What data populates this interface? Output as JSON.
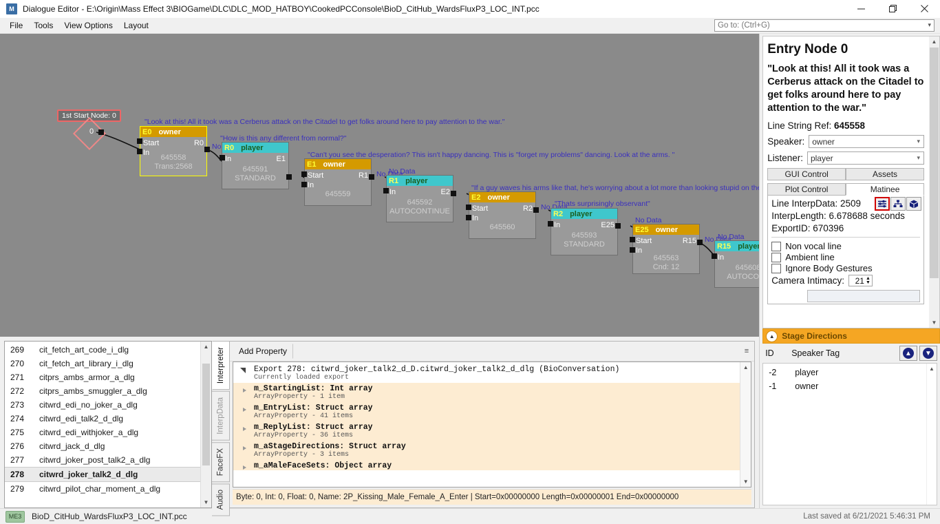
{
  "window": {
    "app_icon_text": "M",
    "title": "Dialogue Editor - E:\\Origin\\Mass Effect 3\\BIOGame\\DLC\\DLC_MOD_HATBOY\\CookedPCConsole\\BioD_CitHub_WardsFluxP3_LOC_INT.pcc",
    "minimize": "—",
    "maximize": "❐",
    "close": "✕"
  },
  "menubar": {
    "items": [
      "File",
      "Tools",
      "View Options",
      "Layout"
    ],
    "goto_placeholder": "Go to: (Ctrl+G)",
    "goto_value": ""
  },
  "graph": {
    "start_chip": "1st Start Node: 0",
    "diamond_label": "0",
    "nodes": [
      {
        "id": "E0",
        "type": "entry",
        "speaker": "owner",
        "selected": true,
        "left_ports": [
          "Start",
          "In"
        ],
        "right_port": "R0",
        "lines": [
          "645558",
          "Trans:2568"
        ],
        "dialogue": "\"Look at this! All it took was a Cerberus attack on the Citadel to get folks around here to pay attention to the war.\"",
        "outlabel": "No Data"
      },
      {
        "id": "R0",
        "type": "reply",
        "speaker": "player",
        "selected": false,
        "left_ports": [
          "In"
        ],
        "right_port": "E1",
        "lines": [
          "645591",
          "STANDARD"
        ],
        "dialogue": "\"How is this any different from normal?\"",
        "outlabel": "No Data"
      },
      {
        "id": "E1",
        "type": "entry",
        "speaker": "owner",
        "selected": false,
        "left_ports": [
          "Start",
          "In"
        ],
        "right_port": "R1",
        "lines": [
          "645559"
        ],
        "dialogue": "\"Can't you see the desperation? This isn't happy dancing. This is \"forget my problems\" dancing. Look at the arms. \"",
        "outlabel": "No Data"
      },
      {
        "id": "R1",
        "type": "reply",
        "speaker": "player",
        "selected": false,
        "left_ports": [
          "In"
        ],
        "right_port": "E2",
        "lines": [
          "645592",
          "AUTOCONTINUE"
        ],
        "dialogue": "No Data",
        "outlabel": "No Data"
      },
      {
        "id": "E2",
        "type": "entry",
        "speaker": "owner",
        "selected": false,
        "left_ports": [
          "Start",
          "In"
        ],
        "right_port": "R2",
        "lines": [
          "645560"
        ],
        "dialogue": "\"If a guy waves his arms like that, he's worrying about a lot more than looking stupid on the dance",
        "outlabel": "No Data"
      },
      {
        "id": "R2",
        "type": "reply",
        "speaker": "player",
        "selected": false,
        "left_ports": [
          "In"
        ],
        "right_port": "E25",
        "lines": [
          "645593",
          "STANDARD"
        ],
        "dialogue": "\"Thats surprisingly observant\"",
        "outlabel": "No Data"
      },
      {
        "id": "E25",
        "type": "entry",
        "speaker": "owner",
        "selected": false,
        "left_ports": [
          "Start",
          "In"
        ],
        "right_port": "R15",
        "lines": [
          "645563",
          "Cnd: 12"
        ],
        "dialogue": "No Data",
        "outlabel": "No Data"
      },
      {
        "id": "R15",
        "type": "reply",
        "speaker": "player",
        "selected": false,
        "left_ports": [
          "In"
        ],
        "right_port": "",
        "lines": [
          "645608",
          "AUTOCONT"
        ],
        "dialogue": "No Data",
        "outlabel": ""
      }
    ]
  },
  "file_list": {
    "rows": [
      {
        "index": "269",
        "name": "cit_fetch_art_code_i_dlg",
        "selected": false
      },
      {
        "index": "270",
        "name": "cit_fetch_art_library_i_dlg",
        "selected": false
      },
      {
        "index": "271",
        "name": "citprs_ambs_armor_a_dlg",
        "selected": false
      },
      {
        "index": "272",
        "name": "citprs_ambs_smuggler_a_dlg",
        "selected": false
      },
      {
        "index": "273",
        "name": "citwrd_edi_no_joker_a_dlg",
        "selected": false
      },
      {
        "index": "274",
        "name": "citwrd_edi_talk2_d_dlg",
        "selected": false
      },
      {
        "index": "275",
        "name": "citwrd_edi_withjoker_a_dlg",
        "selected": false
      },
      {
        "index": "276",
        "name": "citwrd_jack_d_dlg",
        "selected": false
      },
      {
        "index": "277",
        "name": "citwrd_joker_post_talk2_a_dlg",
        "selected": false
      },
      {
        "index": "278",
        "name": "citwrd_joker_talk2_d_dlg",
        "selected": true
      },
      {
        "index": "279",
        "name": "citwrd_pilot_char_moment_a_dlg",
        "selected": false
      }
    ]
  },
  "vtabs": [
    {
      "label": "Interpreter",
      "active": true
    },
    {
      "label": "InterpData",
      "active": false
    },
    {
      "label": "FaceFX",
      "active": false
    },
    {
      "label": "Audio",
      "active": false
    }
  ],
  "interpreter": {
    "add_property_label": "Add Property",
    "overflow_glyph": "≡",
    "export_header": "Export 278: citwrd_joker_talk2_d_D.citwrd_joker_talk2_d_dlg (BioConversation)",
    "export_sub": "Currently loaded export",
    "properties": [
      {
        "name": "m_StartingList: Int array",
        "detail": "ArrayProperty - 1 item"
      },
      {
        "name": "m_EntryList: Struct array",
        "detail": "ArrayProperty - 41 items"
      },
      {
        "name": "m_ReplyList: Struct array",
        "detail": "ArrayProperty - 36 items"
      },
      {
        "name": "m_aStageDirections: Struct array",
        "detail": "ArrayProperty - 3 items"
      },
      {
        "name": "m_aMaleFaceSets: Object array",
        "detail": ""
      }
    ],
    "status_line": "Byte: 0, Int: 0, Float: 0, Name: 2P_Kissing_Male_Female_A_Enter | Start=0x00000000 Length=0x00000001 End=0x00000000"
  },
  "inspector": {
    "node_title": "Entry Node 0",
    "node_line": "\"Look at this! All it took was a Cerberus attack on the Citadel to get folks around here to pay attention to the war.\"",
    "line_string_ref_label": "Line String Ref:",
    "line_string_ref_value": "645558",
    "speaker_label": "Speaker:",
    "speaker_value": "owner",
    "listener_label": "Listener:",
    "listener_value": "player",
    "tabs": [
      {
        "label": "GUI Control",
        "active": false
      },
      {
        "label": "Assets",
        "active": false
      },
      {
        "label": "Plot Control",
        "active": false
      },
      {
        "label": "Matinee",
        "active": true
      }
    ],
    "matinee": {
      "interp_data_label": "Line InterpData:",
      "interp_data_value": "2509",
      "interp_length_label": "InterpLength:",
      "interp_length_value": "6.678688 seconds",
      "export_id_label": "ExportID:",
      "export_id_value": "670396",
      "icons": [
        {
          "name": "sliders-icon",
          "highlighted": true
        },
        {
          "name": "tree-icon",
          "highlighted": false
        },
        {
          "name": "cube-icon",
          "highlighted": false
        }
      ]
    },
    "checkboxes": [
      {
        "label": "Non vocal line",
        "checked": false
      },
      {
        "label": "Ambient line",
        "checked": false
      },
      {
        "label": "Ignore Body Gestures",
        "checked": false
      }
    ],
    "camera_intimacy_label": "Camera Intimacy:",
    "camera_intimacy_value": "21"
  },
  "stage_directions": {
    "header": "Stage Directions",
    "collapse_glyph": "▲",
    "columns": [
      "ID",
      "Speaker Tag"
    ],
    "up_button": "▲",
    "down_button": "▼",
    "rows": [
      {
        "id": "-2",
        "speaker_tag": "player"
      },
      {
        "id": "-1",
        "speaker_tag": "owner"
      }
    ]
  },
  "statusbar": {
    "badge": "ME3",
    "file": "BioD_CitHub_WardsFluxP3_LOC_INT.pcc",
    "saved": "Last saved at 6/21/2021 5:46:31 PM"
  },
  "colors": {
    "entry_header": "#d49a00",
    "reply_header": "#3fc7cc",
    "graph_bg": "#8a8a8a",
    "accent_orange": "#f5a623",
    "selected_outline": "#ffff00"
  }
}
